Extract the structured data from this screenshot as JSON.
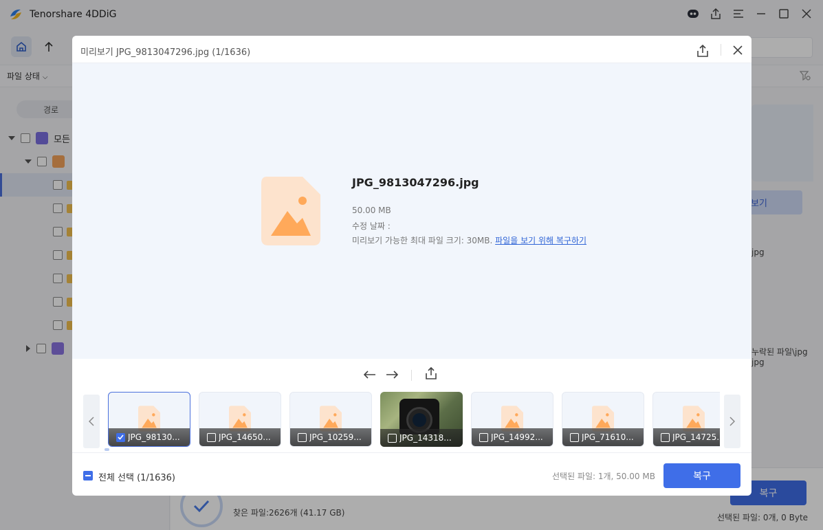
{
  "app": {
    "title": "Tenorshare 4DDiG"
  },
  "filter": {
    "label": "파일 상태"
  },
  "sidebar": {
    "path_tab": "경로",
    "root_label": "모든"
  },
  "background": {
    "preview_button": "보기",
    "text_jpg_1": "jpg",
    "text_missing_files": "누락된 파일\\jpg",
    "text_jpg_2": "jpg",
    "found_files": "찾은 파일:2626개 (41.17 GB)",
    "recover_button": "복구",
    "selected_files": "선택된 파일: 0개, 0 Byte"
  },
  "modal": {
    "title": "미리보기 JPG_9813047296.jpg (1/1636)",
    "file_name": "JPG_9813047296.jpg",
    "file_size": "50.00 MB",
    "modified_date": "수정 날짜 :",
    "note_prefix": "미리보기 가능한 최대 파일 크기: 30MB.",
    "note_link": "파일을 보기 위해 복구하기",
    "thumbnails": [
      {
        "label": "JPG_98130...",
        "checked": true
      },
      {
        "label": "JPG_14650...",
        "checked": false
      },
      {
        "label": "JPG_10259...",
        "checked": false
      },
      {
        "label": "JPG_14318...",
        "checked": false
      },
      {
        "label": "JPG_14992...",
        "checked": false
      },
      {
        "label": "JPG_71610...",
        "checked": false
      },
      {
        "label": "JPG_14725...",
        "checked": false
      }
    ],
    "select_all": "전체 선택 (1/1636)",
    "selected_info": "선택된 파일: 1개, 50.00 MB",
    "recover_button": "복구"
  },
  "colors": {
    "accent": "#3f6ee8",
    "image_icon_bg": "#fde3cd",
    "image_icon_fg": "#ffa95a"
  }
}
